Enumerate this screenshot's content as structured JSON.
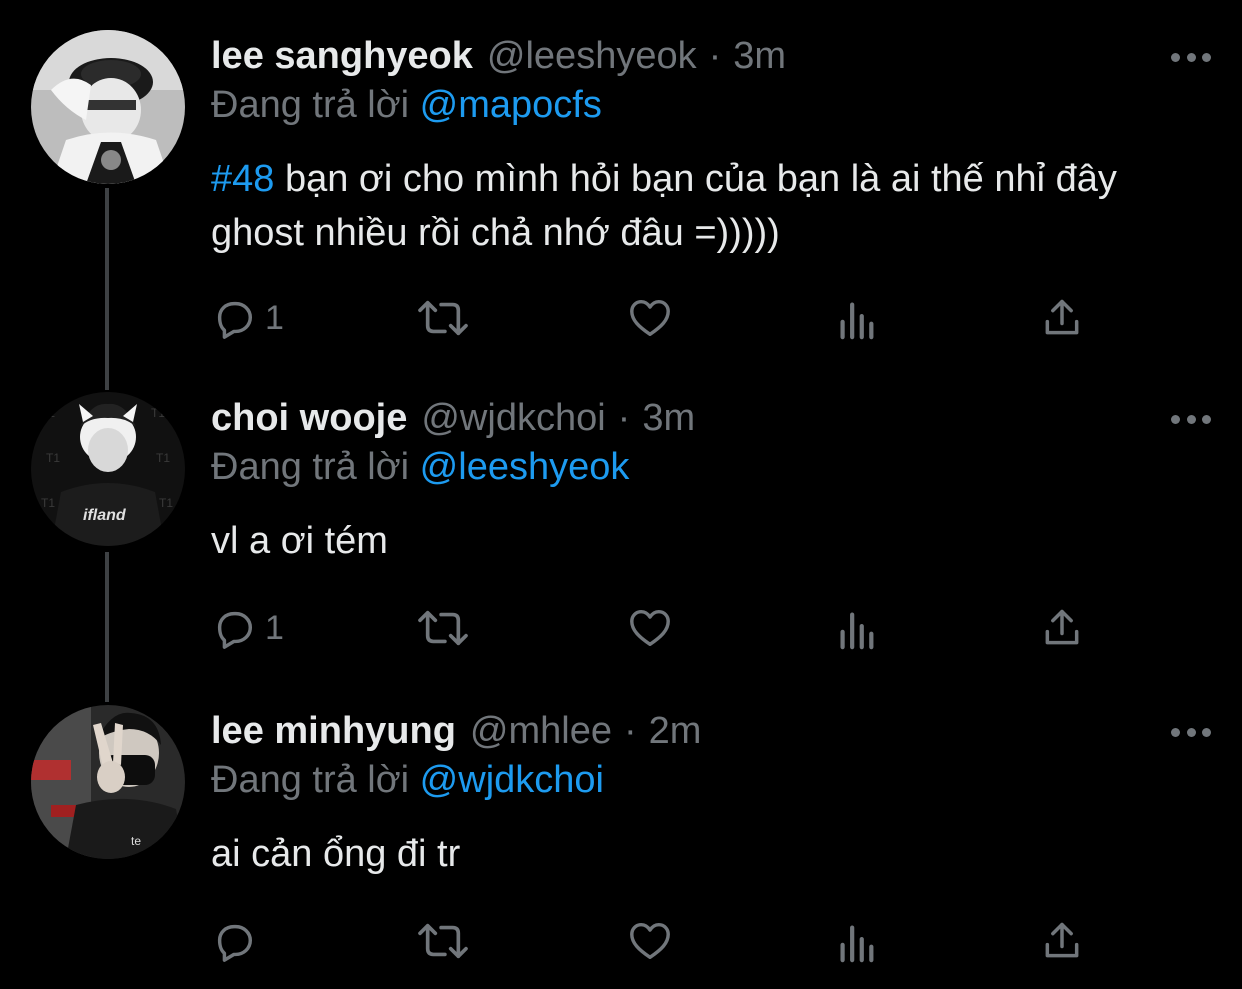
{
  "colors": {
    "background": "#000000",
    "text": "#e7e9ea",
    "muted": "#71767b",
    "accent": "#1d9bf0",
    "thread_line": "#3e4144"
  },
  "tweets": [
    {
      "name": "lee sanghyeok",
      "handle": "@leeshyeok",
      "separator": "·",
      "time": "3m",
      "reply_prefix": "Đang trả lời",
      "reply_to": "@mapocfs",
      "hashtag": "#48",
      "text": " bạn ơi cho mình hỏi bạn của bạn là ai thế nhỉ đây ghost nhiều rồi chả nhớ đâu =)))))",
      "reply_count": "1"
    },
    {
      "name": "choi wooje",
      "handle": "@wjdkchoi",
      "separator": "·",
      "time": "3m",
      "reply_prefix": "Đang trả lời",
      "reply_to": "@leeshyeok",
      "text": "vl a ơi tém",
      "reply_count": "1"
    },
    {
      "name": "lee minhyung",
      "handle": "@mhlee",
      "separator": "·",
      "time": "2m",
      "reply_prefix": "Đang trả lời",
      "reply_to": "@wjdkchoi",
      "text": "ai cản ổng đi tr",
      "reply_count": ""
    }
  ],
  "action_icons": [
    "reply-icon",
    "retweet-icon",
    "like-icon",
    "views-icon",
    "share-icon"
  ]
}
